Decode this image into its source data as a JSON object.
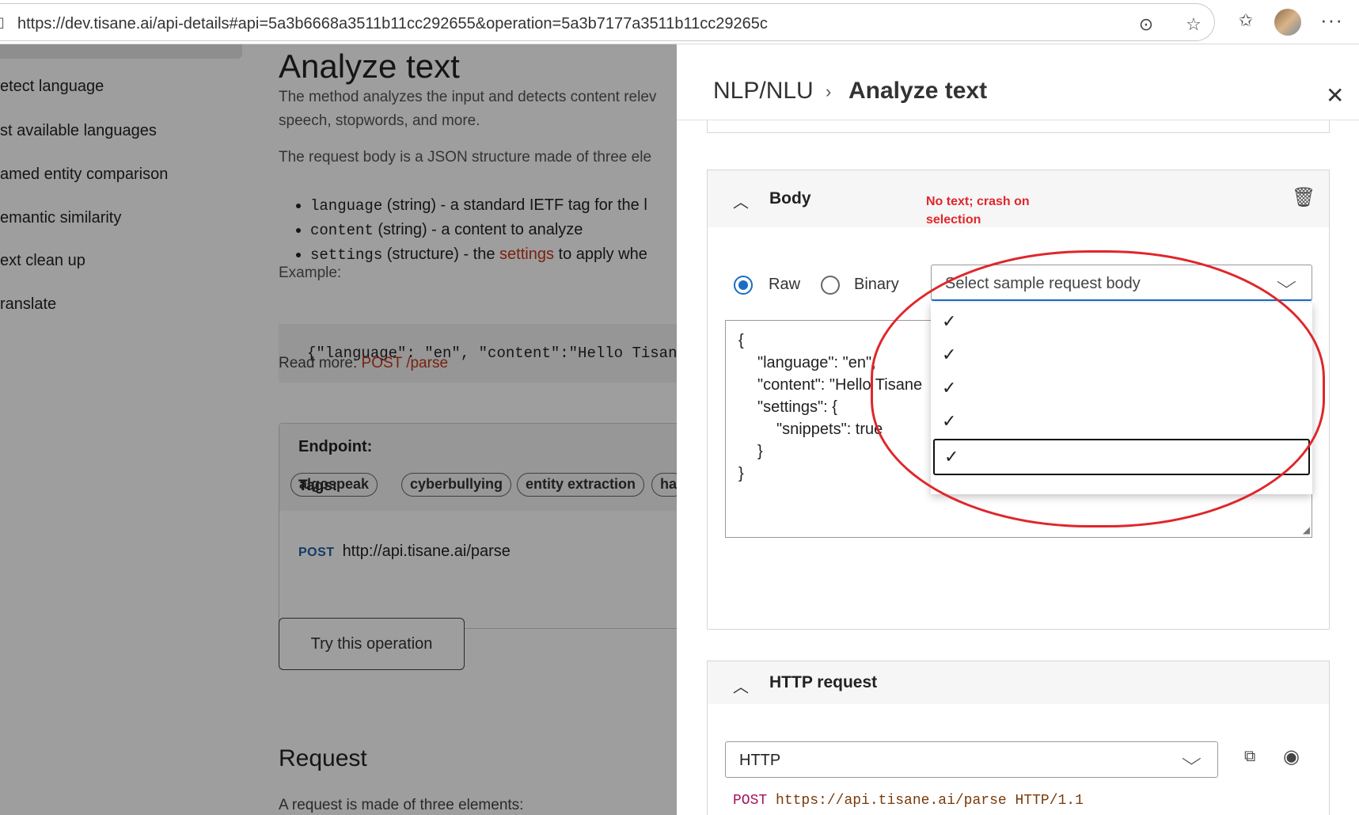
{
  "browser": {
    "url": "https://dev.tisane.ai/api-details#api=5a3b6668a3511b11cc292655&operation=5a3b7177a3511b11cc29265c"
  },
  "sidebar": {
    "items": [
      {
        "label": "etect language"
      },
      {
        "label": "st available languages"
      },
      {
        "label": "amed entity comparison"
      },
      {
        "label": "emantic similarity"
      },
      {
        "label": "ext clean up"
      },
      {
        "label": "ranslate"
      }
    ]
  },
  "main": {
    "title": "Analyze text",
    "desc_line1": "The method analyzes the input and detects content relev",
    "desc_line2": "speech, stopwords, and more.",
    "desc_line3": "The request body is a JSON structure made of three ele",
    "bullets": [
      {
        "code": "language",
        "text": " (string) - a standard IETF tag for the l"
      },
      {
        "code": "content",
        "text": " (string) - a content to analyze"
      },
      {
        "code": "settings",
        "text_pre": " (structure) - the ",
        "link": "settings",
        "text_post": " to apply whe"
      }
    ],
    "example_label": "Example:",
    "example_code": "{\"language\": \"en\", \"content\":\"Hello Tisan",
    "read_more_label": "Read more: ",
    "read_more_link": "POST /parse",
    "endpoint_label": "Endpoint:",
    "tags_label": "Tags:",
    "tags": [
      "algospeak",
      "cyberbullying",
      "entity extraction",
      "ha"
    ],
    "post_verb": "POST",
    "post_url": "http://api.tisane.ai/parse",
    "try_button": "Try this operation",
    "request_title": "Request",
    "request_sub": "A request is made of three elements:"
  },
  "panel": {
    "crumb_parent": "NLP/NLU",
    "crumb_sep": "›",
    "crumb_title": "Analyze text",
    "body_card": {
      "title": "Body",
      "annotation_line1": "No text; crash on",
      "annotation_line2": "selection",
      "radio_raw": "Raw",
      "radio_binary": "Binary",
      "select_placeholder": "Select sample request body",
      "code_lines": [
        "{",
        "\"language\": \"en\",",
        "\"content\": \"Hello Tisane",
        "\"settings\": {",
        "\"snippets\": true",
        "}",
        "}"
      ],
      "dropdown_checks": [
        "✓",
        "✓",
        "✓",
        "✓",
        "✓"
      ]
    },
    "http_card": {
      "title": "HTTP request",
      "protocol": "HTTP",
      "verb": "POST",
      "url": "https://api.tisane.ai/parse HTTP/1.1"
    }
  },
  "colors": {
    "accent": "#1a6dc4",
    "annotation_red": "#e0262b",
    "link": "#c4361a"
  }
}
